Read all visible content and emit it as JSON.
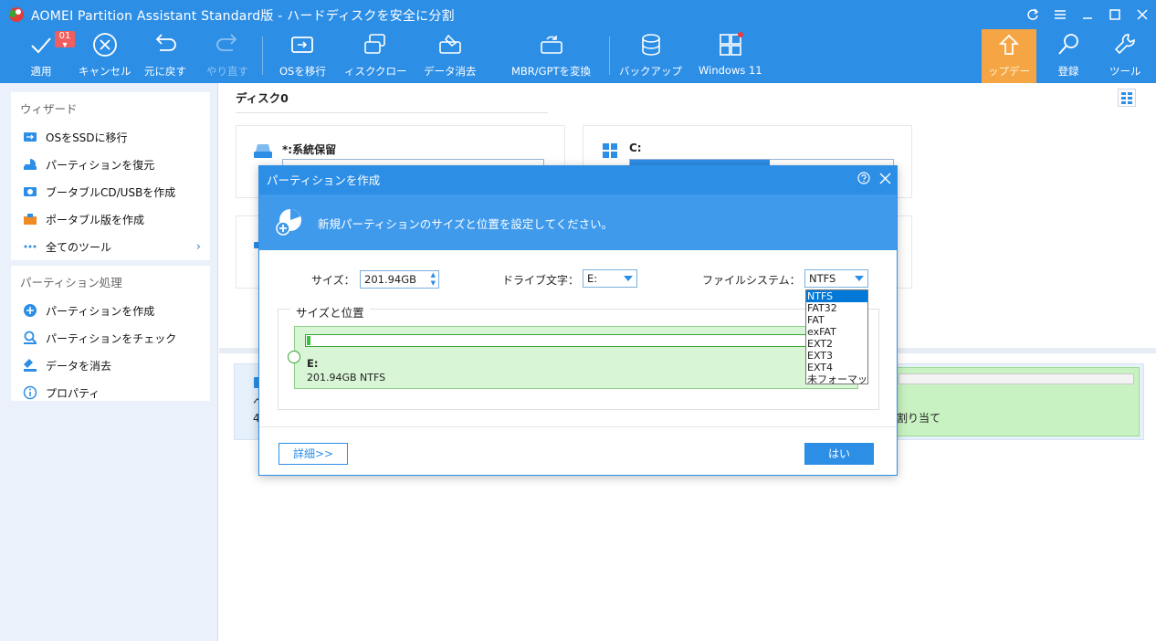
{
  "window": {
    "title": "AOMEI Partition Assistant Standard版 - ハードディスクを安全に分割"
  },
  "toolbar": {
    "apply": "適用",
    "apply_badge": "01",
    "cancel": "キャンセル",
    "undo": "元に戻す",
    "redo": "やり直す",
    "migrate_os": "OSを移行",
    "disk_clone": "ィスククロー",
    "wipe_data": "データ消去",
    "mbr_gpt": "MBR/GPTを変換",
    "backup": "バックアップ",
    "windows11": "Windows 11",
    "update": "ップデー",
    "register": "登録",
    "tools": "ツール"
  },
  "sidebar": {
    "wizard_title": "ウィザード",
    "wizard_items": [
      {
        "label": "OSをSSDに移行",
        "icon": "migrate-icon"
      },
      {
        "label": "パーティションを復元",
        "icon": "recover-icon"
      },
      {
        "label": "ブータブルCD/USBを作成",
        "icon": "bootable-icon"
      },
      {
        "label": "ポータブル版を作成",
        "icon": "portable-icon"
      },
      {
        "label": "全てのツール",
        "icon": "more-icon"
      }
    ],
    "partition_title": "パーティション処理",
    "partition_items": [
      {
        "label": "パーティションを作成",
        "icon": "create-partition-icon"
      },
      {
        "label": "パーティションをチェック",
        "icon": "check-icon"
      },
      {
        "label": "データを消去",
        "icon": "wipe-icon"
      },
      {
        "label": "プロパティ",
        "icon": "info-icon"
      }
    ]
  },
  "main": {
    "disk_label": "ディスク0",
    "cards": [
      {
        "name": "*:系統保留"
      },
      {
        "name": "C:"
      }
    ],
    "lower_partial_1": "へ",
    "lower_partial_2": "4",
    "lower_alloc_text": "割り当て"
  },
  "dialog": {
    "title": "パーティションを作成",
    "banner": "新規パーティションのサイズと位置を設定してください。",
    "size_label": "サイズ：",
    "size_value": "201.94GB",
    "drive_label": "ドライブ文字：",
    "drive_value": "E:",
    "fs_label": "ファイルシステム：",
    "fs_value": "NTFS",
    "fs_options": [
      "NTFS",
      "FAT32",
      "FAT",
      "exFAT",
      "EXT2",
      "EXT3",
      "EXT4",
      "未フォーマット"
    ],
    "group_title": "サイズと位置",
    "partition_name": "E:",
    "partition_info": "201.94GB NTFS",
    "detail_button": "詳細>>",
    "ok_button": "はい"
  },
  "colors": {
    "accent": "#2d8ee6",
    "update_orange": "#f5a544",
    "partition_green": "#d8f5d5"
  }
}
